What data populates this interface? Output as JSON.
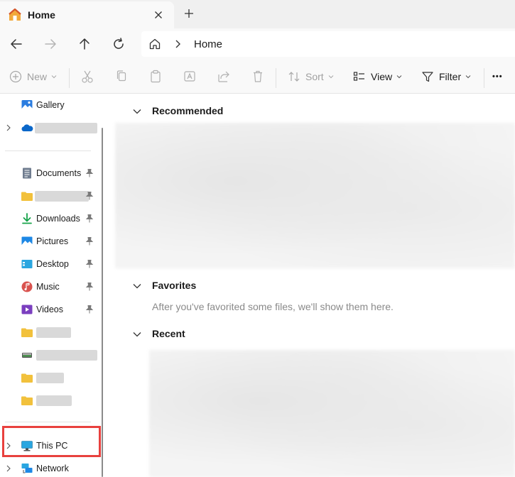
{
  "tab": {
    "title": "Home",
    "close_label": "×",
    "new_tab_label": "+"
  },
  "address": {
    "crumb": "Home"
  },
  "toolbar": {
    "new_label": "New",
    "sort_label": "Sort",
    "view_label": "View",
    "filter_label": "Filter",
    "more_label": "•••"
  },
  "sidebar": {
    "gallery": "Gallery",
    "documents": "Documents",
    "downloads": "Downloads",
    "pictures": "Pictures",
    "desktop": "Desktop",
    "music": "Music",
    "videos": "Videos",
    "this_pc": "This PC",
    "network": "Network"
  },
  "main": {
    "recommended": "Recommended",
    "favorites": "Favorites",
    "favorites_empty": "After you've favorited some files, we'll show them here.",
    "recent": "Recent"
  },
  "colors": {
    "highlight_border": "#e8413e",
    "folder_yellow": "#f2c13c",
    "onedrive_blue": "#0a67c9",
    "download_green": "#16a34a",
    "accent_blue": "#0a67c9"
  }
}
